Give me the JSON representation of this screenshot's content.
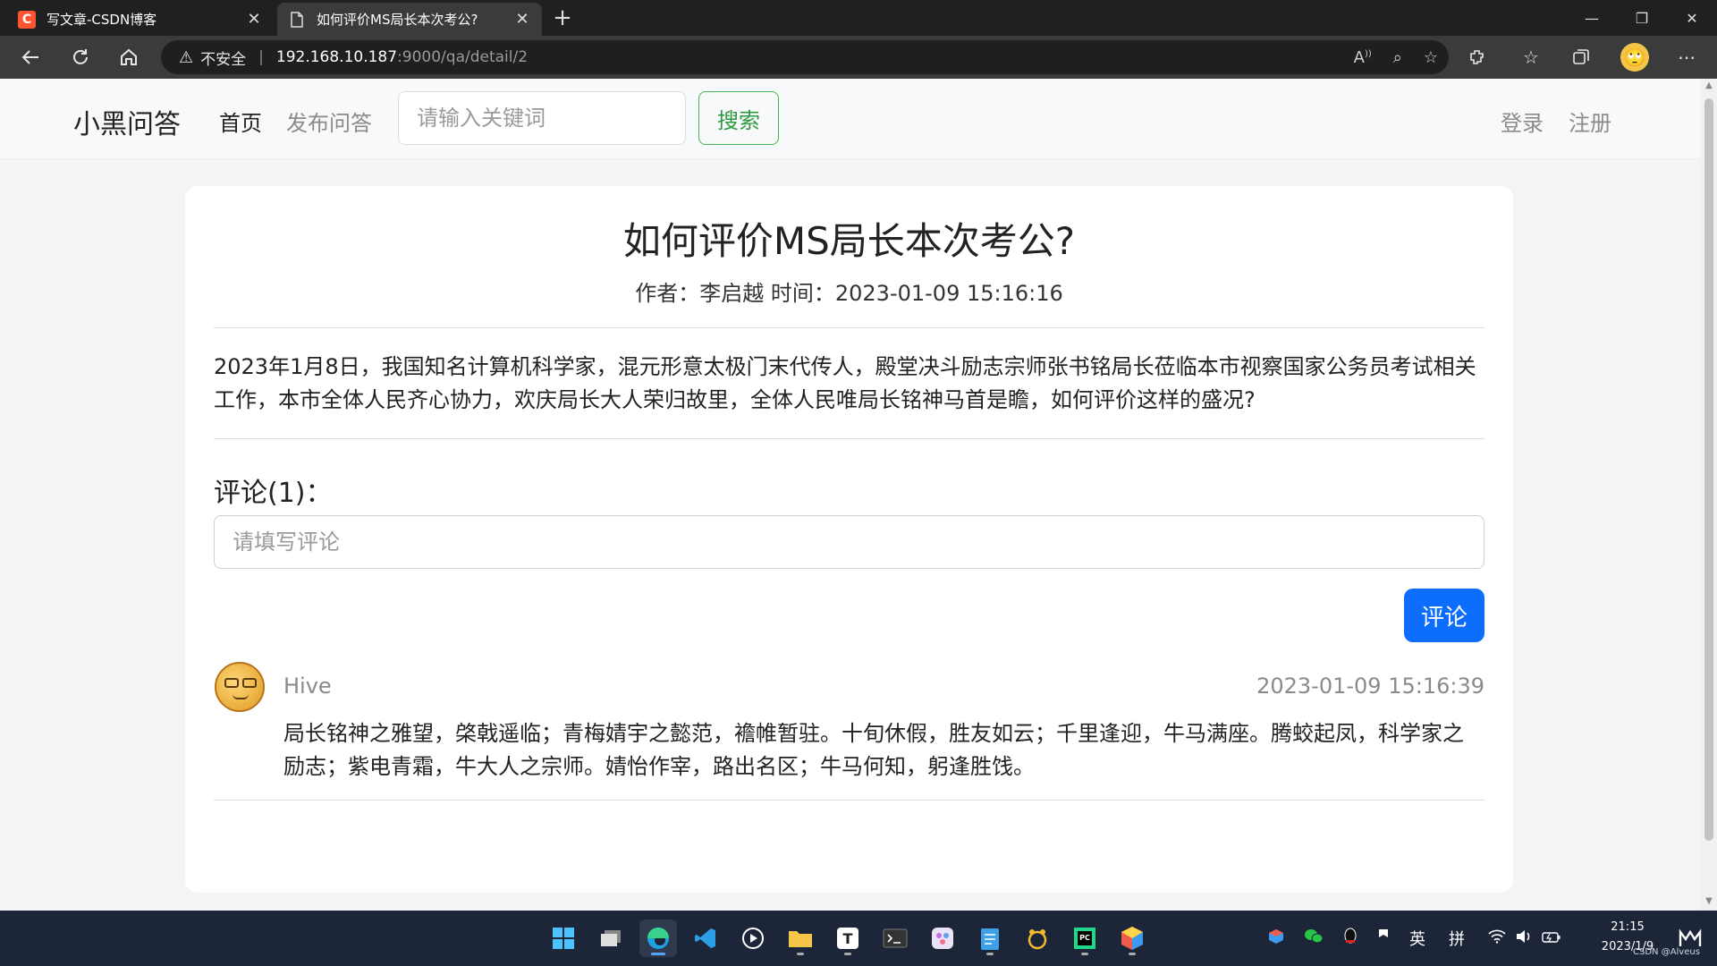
{
  "browser": {
    "tabs": [
      {
        "title": "写文章-CSDN博客",
        "favicon": "C",
        "active": false
      },
      {
        "title": "如何评价MS局长本次考公?",
        "favicon": "page-icon",
        "active": true
      }
    ],
    "new_tab_glyph": "+",
    "window_controls": [
      "—",
      "❐",
      "✕"
    ],
    "address": {
      "security_label": "不安全",
      "host": "192.168.10.187",
      "path": ":9000/qa/detail/2"
    }
  },
  "site": {
    "brand": "小黑问答",
    "nav": {
      "home": "首页",
      "publish": "发布问答"
    },
    "search": {
      "placeholder": "请输入关键词",
      "button": "搜索"
    },
    "auth": {
      "login": "登录",
      "register": "注册"
    }
  },
  "question": {
    "title": "如何评价MS局长本次考公?",
    "meta": "作者：李启越 时间：2023-01-09 15:16:16",
    "body": "2023年1月8日，我国知名计算机科学家，混元形意太极门末代传人，殿堂决斗励志宗师张书铭局长莅临本市视察国家公务员考试相关工作，本市全体人民齐心协力，欢庆局长大人荣归故里，全体人民唯局长铭神马首是瞻，如何评价这样的盛况?"
  },
  "comments_section": {
    "heading": "评论(1)：",
    "input_placeholder": "请填写评论",
    "submit": "评论",
    "items": [
      {
        "user": "Hive",
        "time": "2023-01-09 15:16:39",
        "body": "局长铭神之雅望，棨戟遥临；青梅婧宇之懿范，襜帷暂驻。十旬休假，胜友如云；千里逢迎，牛马满座。腾蛟起凤，科学家之励志；紫电青霜，牛大人之宗师。婧怡作宰，路出名区；牛马何知，躬逢胜饯。"
      }
    ]
  },
  "taskbar": {
    "tray_lang": "英",
    "tray_ime": "拼",
    "time": "21:15",
    "date": "2023/1/9",
    "watermark": "CSDN @Alveus"
  },
  "colors": {
    "primary_button": "#0d6efd",
    "search_button": "#2e9a3f",
    "page_bg": "#f4f4f4"
  }
}
